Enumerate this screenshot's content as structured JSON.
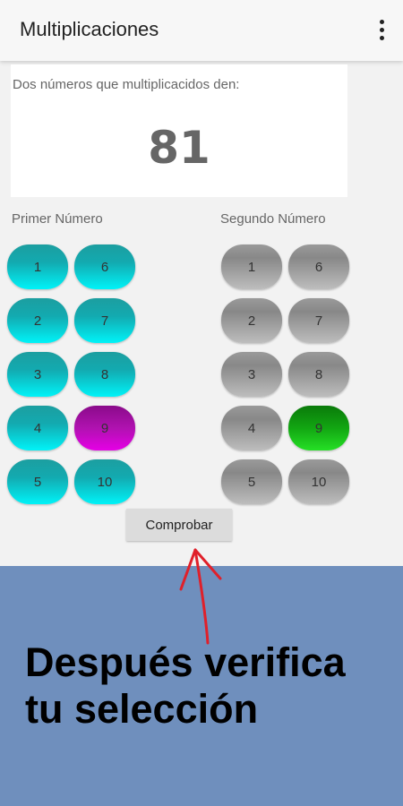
{
  "appbar": {
    "title": "Multiplicaciones",
    "menu_icon": "more-vert-icon"
  },
  "target": {
    "prompt": "Dos números que multiplicacidos den:",
    "number": "81"
  },
  "first_column": {
    "label": "Primer Número",
    "buttons": [
      "1",
      "2",
      "3",
      "4",
      "5",
      "6",
      "7",
      "8",
      "9",
      "10"
    ],
    "selected": "9"
  },
  "second_column": {
    "label": "Segundo Número",
    "buttons": [
      "1",
      "2",
      "3",
      "4",
      "5",
      "6",
      "7",
      "8",
      "9",
      "10"
    ],
    "selected": "9"
  },
  "check_button": {
    "label": "Comprobar"
  },
  "overlay": {
    "caption": "Después verifica tu selección"
  },
  "colors": {
    "first_column_button": "#13aab0",
    "first_column_selected": "#b012b0",
    "second_column_button": "#9a9a9a",
    "second_column_selected": "#12a612",
    "overlay_background": "#6f8fbd",
    "arrow": "#e0202a"
  }
}
